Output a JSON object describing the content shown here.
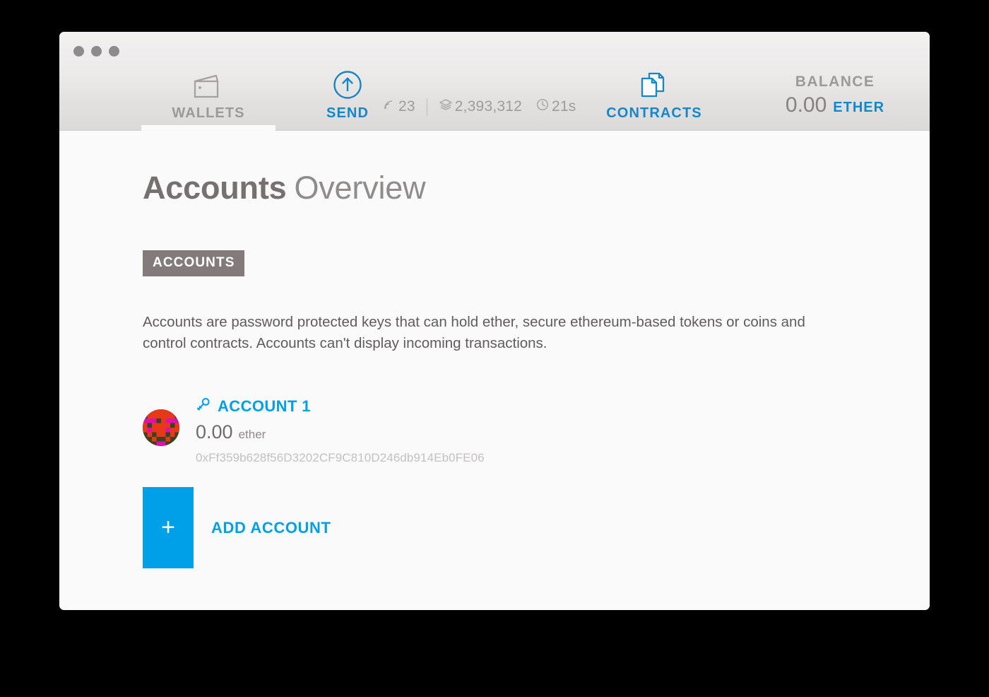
{
  "window": {
    "traffic_lights": [
      "close",
      "minimize",
      "maximize"
    ]
  },
  "toolbar": {
    "tabs": [
      {
        "id": "wallets",
        "label": "WALLETS",
        "icon": "wallet-icon",
        "active": true
      },
      {
        "id": "send",
        "label": "SEND",
        "icon": "send-arrow-up-circle-icon",
        "active": false
      },
      {
        "id": "contracts",
        "label": "CONTRACTS",
        "icon": "documents-icon",
        "active": false
      }
    ],
    "node_stats": {
      "peers_icon": "signal-icon",
      "peers": "23",
      "blocks_icon": "layers-icon",
      "blocks": "2,393,312",
      "time_icon": "clock-icon",
      "time": "21s"
    },
    "balance": {
      "label": "BALANCE",
      "amount": "0.00",
      "unit": "ETHER"
    }
  },
  "main": {
    "title_strong": "Accounts",
    "title_light": "Overview",
    "section_badge": "ACCOUNTS",
    "description": "Accounts are password protected keys that can hold ether, secure ethereum-based tokens or coins and control contracts. Accounts can't display incoming transactions.",
    "accounts": [
      {
        "key_icon": "key-icon",
        "name": "ACCOUNT 1",
        "balance": "0.00",
        "unit": "ether",
        "address": "0xFf359b628f56D3202CF9C810D246db914Eb0FE06"
      }
    ],
    "add_account": {
      "plus": "+",
      "label": "ADD ACCOUNT"
    }
  },
  "colors": {
    "accent_blue": "#00a0e9",
    "toolbar_blue": "#1686c9",
    "badge_gray": "#837b7b",
    "identicon_red": "#e8381a",
    "identicon_magenta": "#e010b0",
    "identicon_olive": "#3d4220"
  }
}
